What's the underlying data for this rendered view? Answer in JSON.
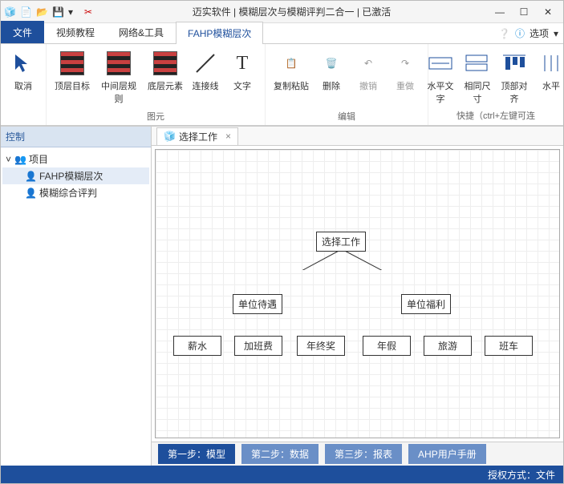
{
  "titlebar": {
    "title": "迈实软件 | 模糊层次与模糊评判二合一 | 已激活"
  },
  "tabs": {
    "file": "文件",
    "items": [
      "视频教程",
      "网络&工具",
      "FAHP模糊层次"
    ],
    "active": 2,
    "options_label": "选项"
  },
  "ribbon": {
    "cancel": "取消",
    "top_goal": "顶层目标",
    "mid_rule": "中间层规则",
    "bot_elem": "底层元素",
    "connector": "连接线",
    "text": "文字",
    "copy_paste": "复制粘贴",
    "delete": "删除",
    "undo": "撤销",
    "redo": "重做",
    "htext": "水平文字",
    "same_size": "相同尺寸",
    "top_align": "顶部对齐",
    "halign": "水平",
    "group_elements": "图元",
    "group_edit": "编辑",
    "shortcut_note": "快捷（ctrl+左键可连"
  },
  "sidebar": {
    "header": "控制",
    "root": "项目",
    "items": [
      "FAHP模糊层次",
      "模糊综合评判"
    ],
    "selected": 0
  },
  "doc": {
    "tab_label": "选择工作"
  },
  "diagram": {
    "L0": "选择工作",
    "L1": [
      "单位待遇",
      "单位福利"
    ],
    "L2": [
      "薪水",
      "加班费",
      "年终奖",
      "年假",
      "旅游",
      "班车"
    ]
  },
  "steps": {
    "s1": "第一步：模型",
    "s2": "第二步：数据",
    "s3": "第三步：报表",
    "s4": "AHP用户手册"
  },
  "status": {
    "license": "授权方式：文件"
  }
}
